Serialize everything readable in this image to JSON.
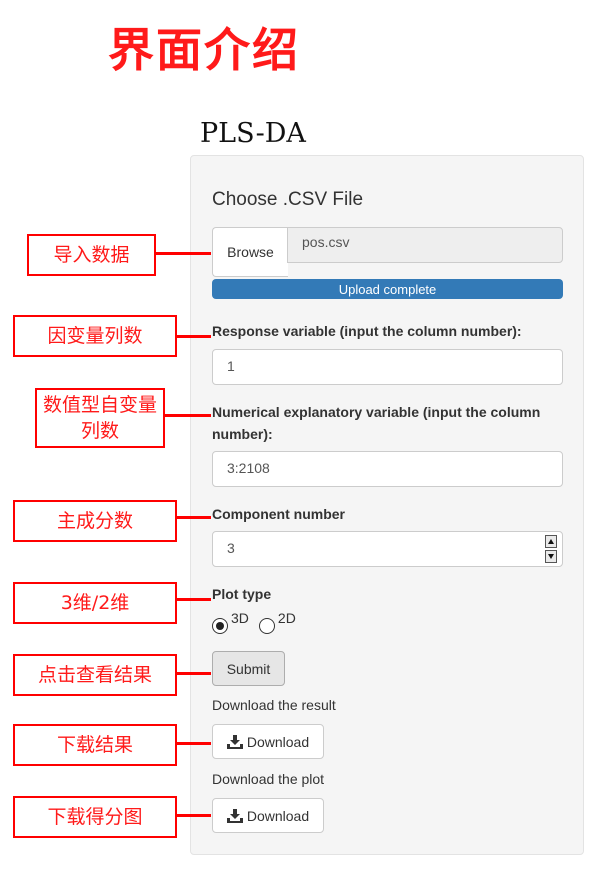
{
  "page_title": "界面介绍",
  "app_title": "PLS-DA",
  "panel": {
    "file_section": {
      "label": "Choose .CSV File",
      "browse_label": "Browse",
      "file_name": "pos.csv",
      "progress_text": "Upload complete",
      "progress": 1.0
    },
    "response": {
      "label": "Response variable (input the column number):",
      "value": "1"
    },
    "explanatory": {
      "label": "Numerical explanatory variable (input the column number):",
      "value": "3:2108"
    },
    "component": {
      "label": "Component number",
      "value": "3"
    },
    "plot_type": {
      "label": "Plot type",
      "options": [
        "3D",
        "2D"
      ],
      "selected": "3D"
    },
    "submit_label": "Submit",
    "download_result": {
      "label": "Download the result",
      "button": "Download"
    },
    "download_plot": {
      "label": "Download the plot",
      "button": "Download"
    }
  },
  "annotations": {
    "import_data": "导入数据",
    "response_col": "因变量列数",
    "explanatory_col": "数值型自变量列数",
    "component": "主成分数",
    "dimension": "3维/2维",
    "view_result": "点击查看结果",
    "download_result": "下载结果",
    "download_plot": "下载得分图"
  },
  "colors": {
    "annotation_red": "#ff0000",
    "progress_blue": "#337ab7",
    "panel_bg": "#f5f5f5"
  },
  "icons": {
    "download": "download-icon",
    "spinner": "spinner-arrows-icon"
  }
}
